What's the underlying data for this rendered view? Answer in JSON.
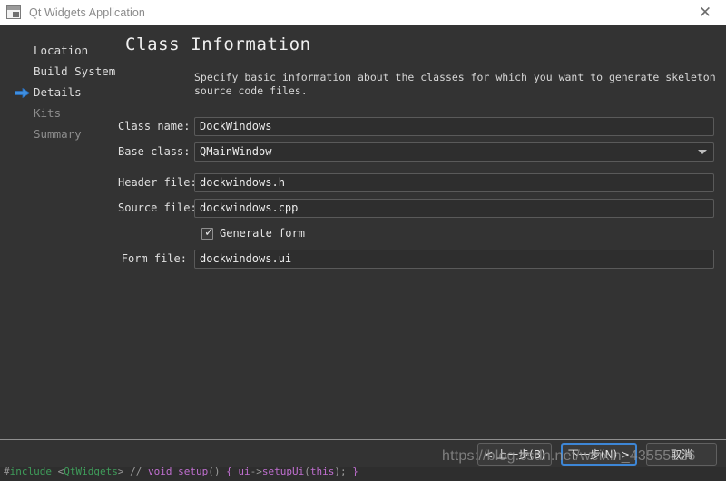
{
  "window": {
    "title": "Qt Widgets Application",
    "icon": "window-widget-icon",
    "close_label": "✕"
  },
  "sidebar": {
    "items": [
      {
        "label": "Location",
        "state": "done",
        "current": false
      },
      {
        "label": "Build System",
        "state": "done",
        "current": false
      },
      {
        "label": "Details",
        "state": "current",
        "current": true
      },
      {
        "label": "Kits",
        "state": "disabled",
        "current": false
      },
      {
        "label": "Summary",
        "state": "disabled",
        "current": false
      }
    ]
  },
  "main": {
    "title": "Class Information",
    "description": "Specify basic information about the classes for which you want to generate skeleton source code files.",
    "fields": [
      {
        "label": "Class name:",
        "value": "DockWindows",
        "type": "text"
      },
      {
        "label": "Base class:",
        "value": "QMainWindow",
        "type": "combo"
      },
      {
        "label": "Header file:",
        "value": "dockwindows.h",
        "type": "text"
      },
      {
        "label": "Source file:",
        "value": "dockwindows.cpp",
        "type": "text"
      },
      {
        "label": "Form file:",
        "value": "dockwindows.ui",
        "type": "text"
      }
    ],
    "checkbox": {
      "label": "Generate form",
      "checked": true,
      "mark": "✓"
    }
  },
  "footer": {
    "buttons": [
      {
        "label": "< 上一步(B)",
        "focused": false
      },
      {
        "label": "下一步(N) >",
        "focused": true
      },
      {
        "label": "取消",
        "focused": false
      }
    ]
  },
  "watermark": {
    "text": "https://blog.csdn.net/weixin_43555226"
  },
  "colors": {
    "dialog_bg": "#333333",
    "titlebar_bg": "#ffffff",
    "accent_focus": "#3d86d6",
    "arrow_blue": "#3f8fe0",
    "text_primary": "#e4e4e4",
    "text_disabled": "#8d8d8d"
  }
}
